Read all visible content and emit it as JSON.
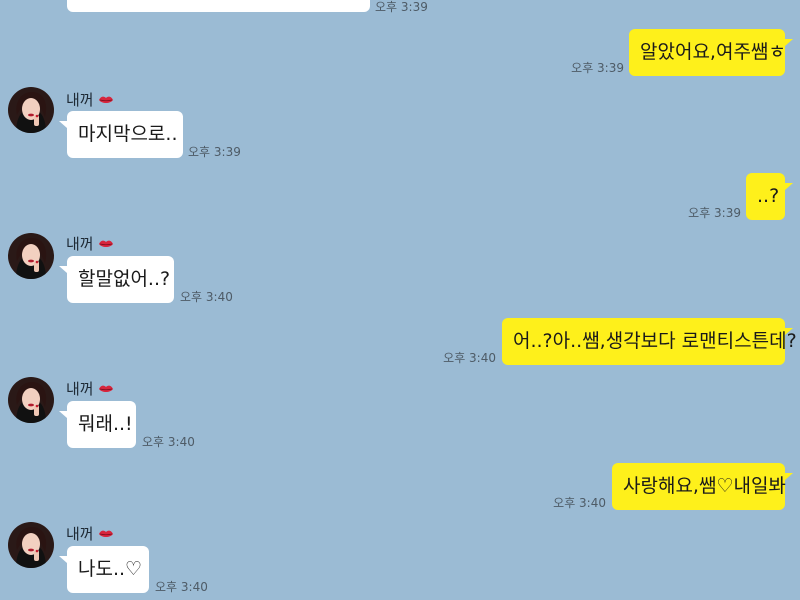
{
  "header": {
    "partial_time": "오후 3:39"
  },
  "contact": {
    "name": "내꺼",
    "name_icon": "lips-emoji-icon",
    "avatar_icon": "profile-photo-avatar"
  },
  "messages": [
    {
      "direction": "out",
      "text": "알았어요,여주쌤ㅎ",
      "time": "오후 3:39"
    },
    {
      "direction": "in",
      "text": "마지막으로..",
      "time": "오후 3:39"
    },
    {
      "direction": "out",
      "text": "..?",
      "time": "오후 3:39"
    },
    {
      "direction": "in",
      "text": "할말없어..?",
      "time": "오후 3:40"
    },
    {
      "direction": "out",
      "text": "어..?아..쌤,생각보다 로맨티스튼데?",
      "time": "오후 3:40"
    },
    {
      "direction": "in",
      "text": "뭐래..!",
      "time": "오후 3:40"
    },
    {
      "direction": "out",
      "text": "사랑해요,쌤♡내일봐",
      "time": "오후 3:40"
    },
    {
      "direction": "in",
      "text": "나도..♡",
      "time": "오후 3:40"
    }
  ],
  "colors": {
    "background": "#9bbbd4",
    "incoming_bubble": "#ffffff",
    "outgoing_bubble": "#fef01b",
    "lips": "#d7263d"
  }
}
